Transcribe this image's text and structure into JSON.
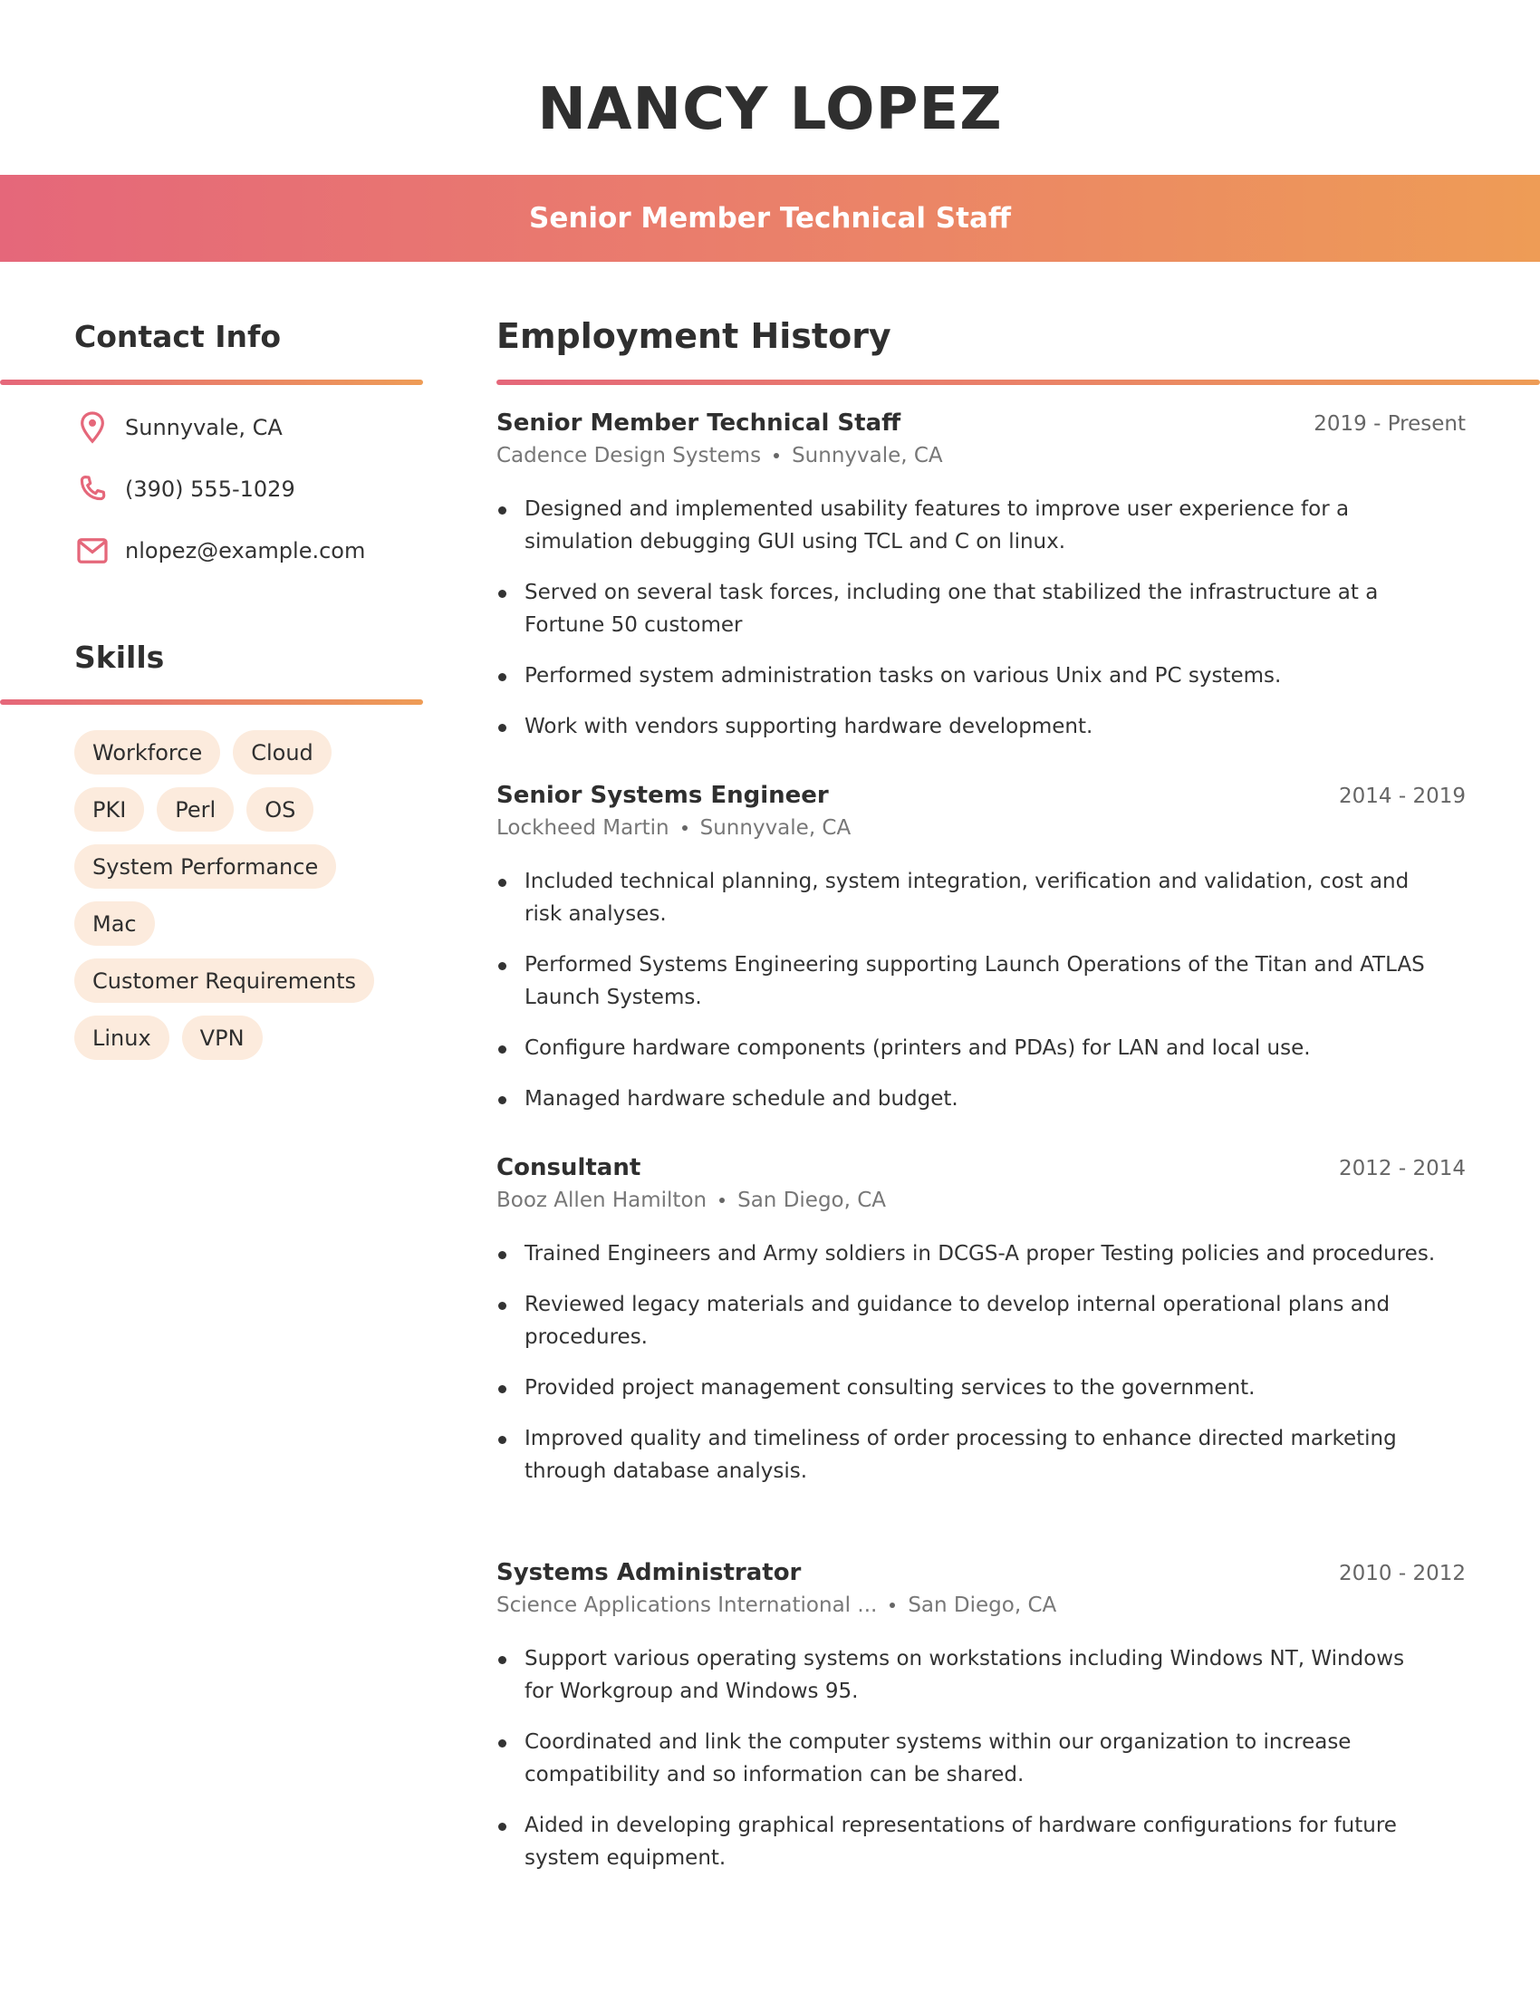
{
  "header": {
    "name": "NANCY LOPEZ",
    "headline": "Senior Member Technical Staff"
  },
  "colors": {
    "gradient_start": "#e5677a",
    "gradient_end": "#ee9c56",
    "icon": "#e5677a",
    "pill_bg": "#fcebdd",
    "text": "#2f2f2f"
  },
  "contact": {
    "title": "Contact Info",
    "items": [
      {
        "icon": "location-pin-icon",
        "text": "Sunnyvale, CA"
      },
      {
        "icon": "phone-icon",
        "text": "(390) 555-1029"
      },
      {
        "icon": "mail-icon",
        "text": "nlopez@example.com"
      }
    ]
  },
  "skills": {
    "title": "Skills",
    "rows": [
      [
        "Workforce",
        "Cloud"
      ],
      [
        "PKI",
        "Perl",
        "OS"
      ],
      [
        "System Performance"
      ],
      [
        "Mac"
      ],
      [
        "Customer Requirements"
      ],
      [
        "Linux",
        "VPN"
      ]
    ]
  },
  "employment": {
    "title": "Employment History",
    "jobs": [
      {
        "title": "Senior Member Technical Staff",
        "dates": "2019 - Present",
        "company": "Cadence Design Systems",
        "location": "Sunnyvale, CA",
        "bullets": [
          "Designed and implemented usability features to improve user experience for a simulation debugging GUI using TCL and C on linux.",
          "Served on several task forces, including one that stabilized the infrastructure at a Fortune 50 customer",
          "Performed system administration tasks on various Unix and PC systems.",
          "Work with vendors supporting hardware development."
        ]
      },
      {
        "title": "Senior Systems Engineer",
        "dates": "2014 - 2019",
        "company": "Lockheed Martin",
        "location": "Sunnyvale, CA",
        "bullets": [
          "Included technical planning, system integration, verification and validation, cost and risk analyses.",
          "Performed Systems Engineering supporting Launch Operations of the Titan and ATLAS Launch Systems.",
          "Configure hardware components (printers and PDAs) for LAN and local use.",
          "Managed hardware schedule and budget."
        ]
      },
      {
        "title": "Consultant",
        "dates": "2012 - 2014",
        "company": "Booz Allen Hamilton",
        "location": "San Diego, CA",
        "bullets": [
          "Trained Engineers and Army soldiers in DCGS-A proper Testing policies and procedures.",
          "Reviewed legacy materials and guidance to develop internal operational plans and procedures.",
          "Provided project management consulting services to the government.",
          "Improved quality and timeliness of order processing to enhance directed marketing through database analysis."
        ]
      },
      {
        "title": "Systems Administrator",
        "dates": "2010 - 2012",
        "company": "Science Applications International ...",
        "location": "San Diego, CA",
        "bullets": [
          "Support various operating systems on workstations including Windows NT, Windows for Workgroup and Windows 95.",
          "Coordinated and link the computer systems within our organization to increase compatibility and so information can be shared.",
          "Aided in developing graphical representations of hardware configurations for future system equipment."
        ]
      }
    ]
  }
}
